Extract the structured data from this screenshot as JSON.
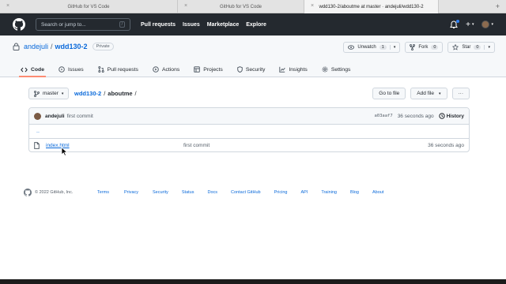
{
  "browser": {
    "tabs": [
      {
        "title": "GitHub for VS Code",
        "active": false
      },
      {
        "title": "GitHub for VS Code",
        "active": false
      },
      {
        "title": "wdd130-2/aboutme at master · andejuli/wdd130-2",
        "active": true
      }
    ],
    "new_tab": "+"
  },
  "header": {
    "search_placeholder": "Search or jump to...",
    "search_shortcut": "/",
    "nav": [
      "Pull requests",
      "Issues",
      "Marketplace",
      "Explore"
    ],
    "plus": "+",
    "caret": "▾"
  },
  "repo": {
    "owner": "andejuli",
    "separator": "/",
    "name": "wdd130-2",
    "visibility": "Private",
    "unwatch_label": "Unwatch",
    "unwatch_count": "1",
    "fork_label": "Fork",
    "fork_count": "0",
    "star_label": "Star",
    "star_count": "0",
    "tabs": [
      {
        "label": "Code",
        "icon": "code-icon",
        "selected": true
      },
      {
        "label": "Issues",
        "icon": "issue-icon",
        "selected": false
      },
      {
        "label": "Pull requests",
        "icon": "pull-request-icon",
        "selected": false
      },
      {
        "label": "Actions",
        "icon": "play-icon",
        "selected": false
      },
      {
        "label": "Projects",
        "icon": "table-icon",
        "selected": false
      },
      {
        "label": "Security",
        "icon": "shield-icon",
        "selected": false
      },
      {
        "label": "Insights",
        "icon": "graph-icon",
        "selected": false
      },
      {
        "label": "Settings",
        "icon": "gear-icon",
        "selected": false
      }
    ]
  },
  "content": {
    "branch": "master",
    "breadcrumb_repo": "wdd130-2",
    "breadcrumb_sep": "/",
    "breadcrumb_dir": "aboutme",
    "breadcrumb_trail": "/",
    "go_to_file": "Go to file",
    "add_file": "Add file",
    "more": "···",
    "commit": {
      "author": "andejuli",
      "message": "first commit",
      "sha": "a03aaf7",
      "age": "36 seconds ago",
      "history_label": "History"
    },
    "parent_dir": "..",
    "files": [
      {
        "name": "index.html",
        "message": "first commit",
        "age": "36 seconds ago"
      }
    ]
  },
  "footer": {
    "copyright": "© 2022 GitHub, Inc.",
    "links": [
      "Terms",
      "Privacy",
      "Security",
      "Status",
      "Docs",
      "Contact GitHub",
      "Pricing",
      "API",
      "Training",
      "Blog",
      "About"
    ]
  },
  "colors": {
    "header_bg": "#24292f",
    "link": "#0969da",
    "selected_tab_underline": "#fd8c73"
  }
}
